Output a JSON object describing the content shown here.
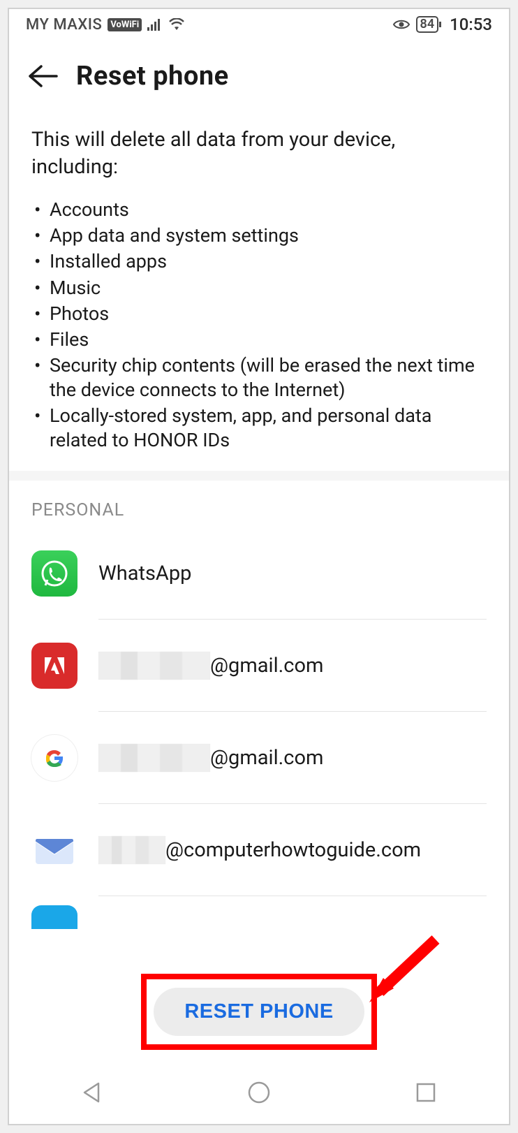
{
  "status_bar": {
    "carrier": "MY MAXIS",
    "vowifi_label": "VoWiFi",
    "battery_percent": "84",
    "time": "10:53"
  },
  "header": {
    "title": "Reset phone"
  },
  "description": "This will delete all data from your device, including:",
  "bullets": [
    "Accounts",
    "App data and system settings",
    "Installed apps",
    "Music",
    "Photos",
    "Files",
    "Security chip contents (will be erased the next time the device connects to the Internet)",
    "Locally-stored system, app, and personal data related to HONOR IDs"
  ],
  "section_label": "PERSONAL",
  "accounts": [
    {
      "icon": "whatsapp",
      "label": "WhatsApp",
      "redacted_prefix": false
    },
    {
      "icon": "adobe",
      "label": "@gmail.com",
      "redacted_prefix": true,
      "redact_class": "w1"
    },
    {
      "icon": "google",
      "label": "@gmail.com",
      "redacted_prefix": true,
      "redact_class": "w2"
    },
    {
      "icon": "mail",
      "label": "@computerhowtoguide.com",
      "redacted_prefix": true,
      "redact_class": "w3"
    },
    {
      "icon": "generic",
      "label": "",
      "redacted_prefix": false
    }
  ],
  "reset_button_label": "RESET PHONE"
}
